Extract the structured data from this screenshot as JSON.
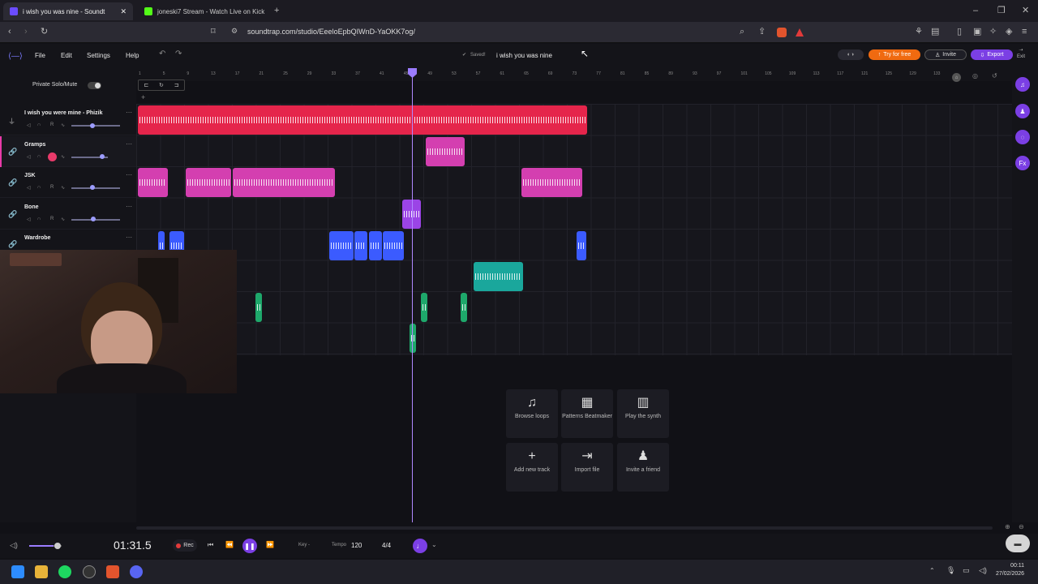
{
  "browser": {
    "tabs": [
      {
        "title": "i wish you was nine - Soundt",
        "active": true,
        "color": "#6b4cff"
      },
      {
        "title": "joneski7 Stream - Watch Live on Kick",
        "active": false,
        "color": "#53fc18"
      }
    ],
    "url": "soundtrap.com/studio/EeeloEpbQIWnD-YaOKK7og/"
  },
  "app": {
    "menu": [
      "File",
      "Edit",
      "Settings",
      "Help"
    ],
    "saved_label": "Saved!",
    "project_title": "i wish you was nine",
    "try_label": "Try for free",
    "invite_label": "Invite",
    "export_label": "Export",
    "exit_label": "Exit",
    "accent": "#7b3fe4"
  },
  "panel": {
    "private_label": "Private Solo/Mute",
    "tracks": [
      {
        "name": "I wish you were mine - Phizik"
      },
      {
        "name": "Gramps"
      },
      {
        "name": "JSK"
      },
      {
        "name": "Bone"
      },
      {
        "name": "Wardrobe"
      }
    ],
    "r_label": "R"
  },
  "ruler": [
    "1",
    "5",
    "9",
    "13",
    "17",
    "21",
    "25",
    "29",
    "33",
    "37",
    "41",
    "45",
    "49",
    "53",
    "57",
    "61",
    "65",
    "69",
    "73",
    "77",
    "81",
    "85",
    "89",
    "93",
    "97",
    "101",
    "105",
    "109",
    "113",
    "117",
    "121",
    "125",
    "129",
    "133"
  ],
  "quickstart": [
    {
      "icon": "music-note-icon",
      "glyph": "♫",
      "label": "Browse loops"
    },
    {
      "icon": "grid-icon",
      "glyph": "▦",
      "label": "Patterns Beatmaker"
    },
    {
      "icon": "piano-icon",
      "glyph": "▥",
      "label": "Play the synth"
    },
    {
      "icon": "plus-icon",
      "glyph": "+",
      "label": "Add new track"
    },
    {
      "icon": "import-icon",
      "glyph": "⇥",
      "label": "Import file"
    },
    {
      "icon": "invite-icon",
      "glyph": "♟",
      "label": "Invite a friend"
    }
  ],
  "transport": {
    "time": "01:31.5",
    "rec_label": "Rec",
    "key_label": "Key",
    "key_value": "-",
    "tempo_label": "Tempo",
    "tempo_value": "120",
    "signature": "4/4"
  },
  "taskbar": {
    "time": "00:11",
    "date": "27/02/2026"
  }
}
